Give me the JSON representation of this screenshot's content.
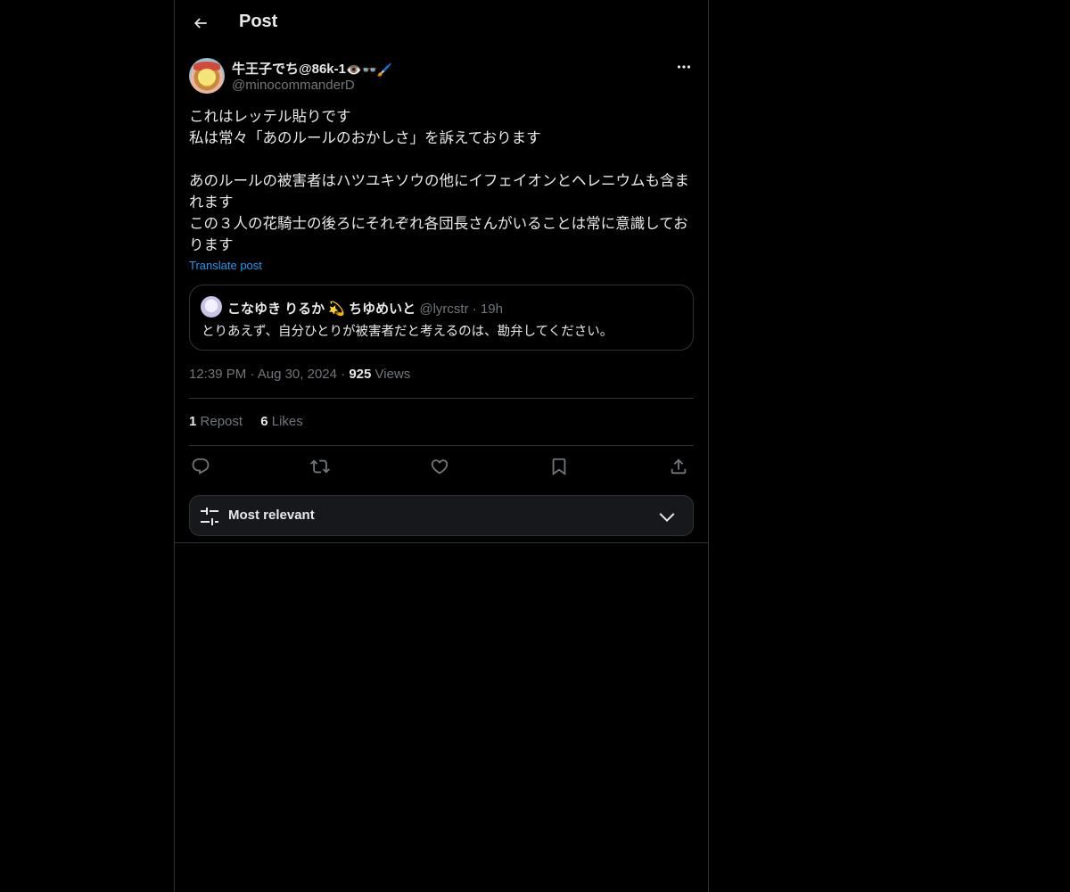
{
  "header": {
    "title": "Post",
    "back_icon": "arrow-left-icon"
  },
  "author": {
    "display_name": "牛王子でち@86k-1",
    "name_emojis": [
      "👁️",
      "👓",
      "🖌️"
    ],
    "handle": "@minocommanderD",
    "more_icon": "ellipsis-icon"
  },
  "post": {
    "text": "これはレッテル貼りです\n私は常々「あのルールのおかしさ」を訴えております\n\nあのルールの被害者はハツユキソウの他にイフェイオンとヘレニウムも含まれます\nこの３人の花騎士の後ろにそれぞれ各団長さんがいることは常に意識しております",
    "translate_label": "Translate post"
  },
  "quote": {
    "name": "こなゆき りるか 💫 ちゆめいと",
    "handle": "@lyrcstr",
    "separator": "·",
    "time": "19h",
    "text": "とりあえず、自分ひとりが被害者だと考えるのは、勘弁してください。"
  },
  "meta": {
    "time": "12:39 PM",
    "separator": "·",
    "date": "Aug 30, 2024",
    "views_count": "925",
    "views_label": "Views"
  },
  "stats": {
    "reposts_count": "1",
    "reposts_label": "Repost",
    "likes_count": "6",
    "likes_label": "Likes"
  },
  "actions": [
    {
      "name": "reply",
      "icon": "reply-icon"
    },
    {
      "name": "repost",
      "icon": "repost-icon"
    },
    {
      "name": "like",
      "icon": "heart-icon"
    },
    {
      "name": "bookmark",
      "icon": "bookmark-icon"
    },
    {
      "name": "share",
      "icon": "share-icon"
    }
  ],
  "sort": {
    "label": "Most relevant",
    "icon": "sliders-icon",
    "chevron": "chevron-down-icon"
  },
  "colors": {
    "background": "#000000",
    "text": "#e7e9ea",
    "muted": "#71767b",
    "link": "#1d9bf0",
    "border": "#2f3336",
    "sort_bg": "#16181c"
  }
}
